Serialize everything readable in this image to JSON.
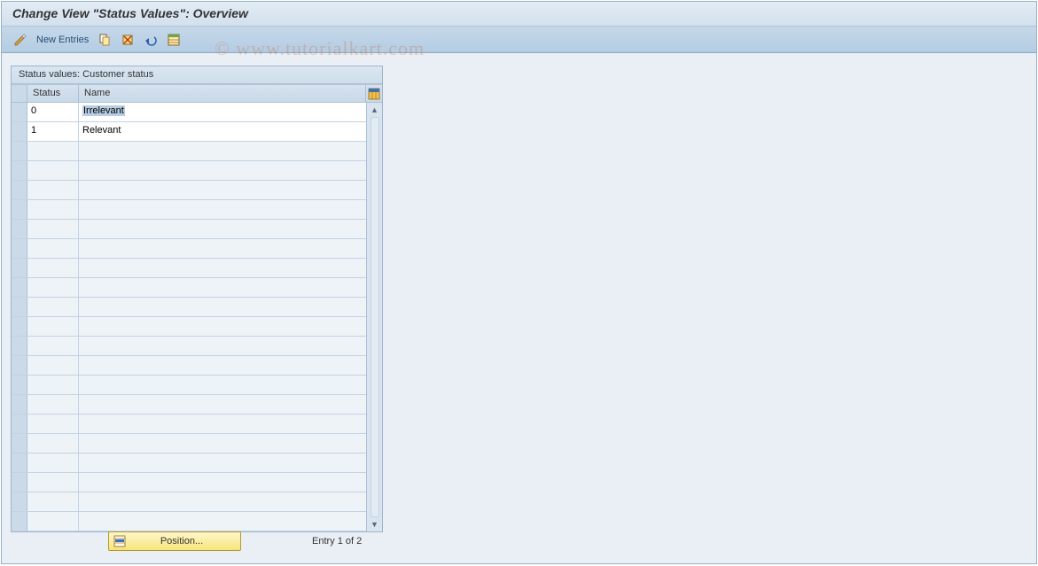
{
  "title": "Change View \"Status Values\": Overview",
  "watermark": "© www.tutorialkart.com",
  "toolbar": {
    "new_entries_label": "New Entries"
  },
  "panel": {
    "title": "Status values: Customer status",
    "columns": {
      "status": "Status",
      "name": "Name"
    },
    "rows": [
      {
        "status": "0",
        "name": "Irrelevant",
        "selected": true
      },
      {
        "status": "1",
        "name": "Relevant",
        "selected": false
      }
    ],
    "empty_row_count": 20
  },
  "footer": {
    "position_label": "Position...",
    "entry_label": "Entry 1 of 2"
  }
}
